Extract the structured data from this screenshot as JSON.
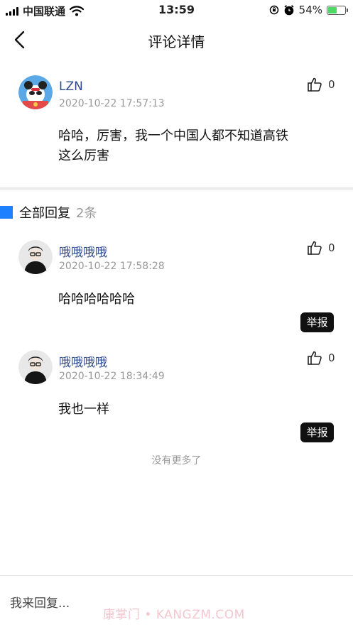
{
  "status_bar": {
    "carrier": "中国联通",
    "time": "13:59",
    "battery_percent": "54%",
    "battery_level": 0.54,
    "icons": [
      "signal-icon",
      "wifi-icon",
      "rotation-lock-icon",
      "alarm-icon",
      "battery-icon"
    ]
  },
  "nav": {
    "title": "评论详情",
    "back_icon": "chevron-left-icon"
  },
  "main_comment": {
    "username": "LZN",
    "time": "2020-10-22 17:57:13",
    "likes": "0",
    "text": "哈哈，厉害，我一个中国人都不知道高铁这么厉害"
  },
  "replies_section": {
    "title": "全部回复",
    "count": "2条",
    "accent": "#1e80ff"
  },
  "replies": [
    {
      "username": "哦哦哦哦",
      "time": "2020-10-22 17:58:28",
      "likes": "0",
      "text": "哈哈哈哈哈哈",
      "report_label": "举报"
    },
    {
      "username": "哦哦哦哦",
      "time": "2020-10-22 18:34:49",
      "likes": "0",
      "text": "我也一样",
      "report_label": "举报"
    }
  ],
  "no_more_text": "没有更多了",
  "reply_bar": {
    "placeholder": "我来回复..."
  },
  "watermark": "康掌门 • KANGZM.COM"
}
